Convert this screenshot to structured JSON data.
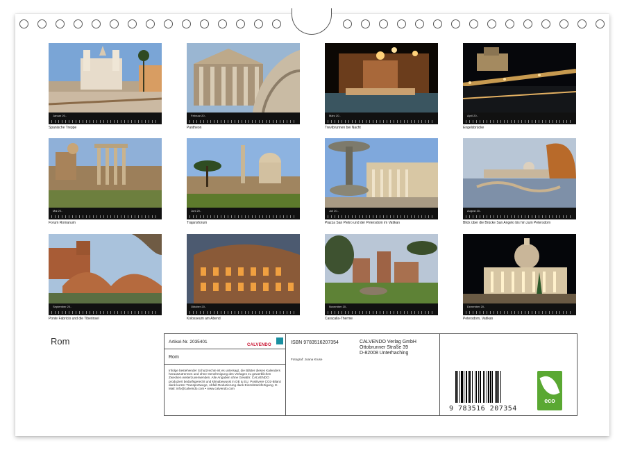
{
  "calendar_title": "Rom",
  "months": [
    {
      "label": "Januar 20..",
      "caption": "Spanische Treppe"
    },
    {
      "label": "Februar 20..",
      "caption": "Pantheon"
    },
    {
      "label": "März 20..",
      "caption": "Trevibrunnen bei Nacht"
    },
    {
      "label": "April 20..",
      "caption": "Engelsbrücke"
    },
    {
      "label": "Mai 20..",
      "caption": "Forum Romanum"
    },
    {
      "label": "Juni 20..",
      "caption": "Trajansforum"
    },
    {
      "label": "Juli 20..",
      "caption": "Piazza San Pietro und der Petersdom im Vatikan"
    },
    {
      "label": "August 20..",
      "caption": "Blick über die Brücke San Angelo bis hin zum Petersdom"
    },
    {
      "label": "September 20..",
      "caption": "Ponte Fabricio und die Tiberinsel"
    },
    {
      "label": "Oktober 20..",
      "caption": "Kolosseum am Abend"
    },
    {
      "label": "November 20..",
      "caption": "Caracalla-Therme"
    },
    {
      "label": "Dezember 20..",
      "caption": "Petersdom, Vatikan"
    }
  ],
  "imprint": {
    "article": "Artikel-Nr. 2035401",
    "title": "Rom",
    "logo": "CALVENDO",
    "legal": "Infolge bestehender Schutzrechte ist es untersagt, die Blätter dieses Kalenders herauszutrennen und ohne Genehmigung des Verlages zu gewerblichen Zwecken weiterzuverwenden. Alle Angaben ohne Gewähr. CALVENDO produziert bedarfsgerecht und klimabewusst in DE & EU. Positivere CO2-Bilanz dank kurzer Transportwege, Abfall-Reduzierung dank Einzelstückfertigung. E-Mail: info@calvendo.com • www.calvendo.com",
    "isbn": "ISBN 9783516207354",
    "publisher_line1": "CALVENDO Verlag GmbH",
    "publisher_line2": "Ottobrunner Straße 39",
    "publisher_line3": "D-82008 Unterhaching",
    "photographer": "Fotograf: Joana Kruse",
    "barcode_digits": "9 783516 207354",
    "eco_label": "eco"
  }
}
